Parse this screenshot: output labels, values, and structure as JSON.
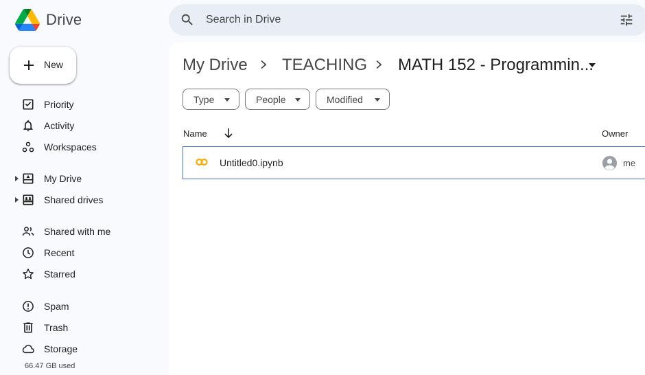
{
  "app": {
    "title": "Drive"
  },
  "search": {
    "placeholder": "Search in Drive"
  },
  "new_button": {
    "label": "New"
  },
  "sidebar": {
    "items": [
      {
        "label": "Priority",
        "icon": "check-circle-icon"
      },
      {
        "label": "Activity",
        "icon": "bell-icon"
      },
      {
        "label": "Workspaces",
        "icon": "workspaces-icon"
      },
      {
        "label": "My Drive",
        "icon": "my-drive-icon",
        "expandable": true
      },
      {
        "label": "Shared drives",
        "icon": "shared-drives-icon",
        "expandable": true
      },
      {
        "label": "Shared with me",
        "icon": "people-icon"
      },
      {
        "label": "Recent",
        "icon": "clock-icon"
      },
      {
        "label": "Starred",
        "icon": "star-icon"
      },
      {
        "label": "Spam",
        "icon": "spam-icon"
      },
      {
        "label": "Trash",
        "icon": "trash-icon"
      },
      {
        "label": "Storage",
        "icon": "cloud-icon"
      }
    ],
    "storage_used": "66.47 GB used"
  },
  "breadcrumb": {
    "items": [
      "My Drive",
      "TEACHING"
    ],
    "current": "MATH 152 - Programmin..."
  },
  "filters": [
    {
      "label": "Type"
    },
    {
      "label": "People"
    },
    {
      "label": "Modified"
    }
  ],
  "table": {
    "columns": {
      "name": "Name",
      "owner": "Owner"
    },
    "sort": "descending",
    "rows": [
      {
        "name": "Untitled0.ipynb",
        "owner": "me",
        "file_icon": "colab-icon",
        "selected": true
      }
    ]
  },
  "colors": {
    "background": "#f8fafd",
    "search_bg": "#e9eef6",
    "selection_border": "#3d6fd0",
    "colab_orange": "#f9ab00"
  }
}
